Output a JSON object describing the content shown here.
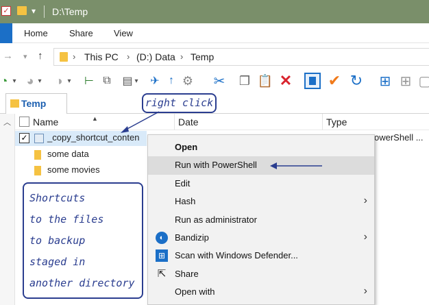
{
  "window": {
    "title": "D:\\Temp"
  },
  "ribbon": {
    "tabs": [
      "Home",
      "Share",
      "View"
    ]
  },
  "address": {
    "crumbs": [
      "This PC",
      "(D:) Data",
      "Temp"
    ]
  },
  "tabs": {
    "active_label": "Temp"
  },
  "columns": {
    "name": "Name",
    "date": "Date",
    "type": "Type"
  },
  "files": [
    {
      "name": "_copy_shortcut_conten",
      "type": "owerShell ...",
      "checked": true,
      "icon": "powershell-script-icon"
    },
    {
      "name": "some data",
      "icon": "shortcut-folder-icon"
    },
    {
      "name": "some movies",
      "icon": "shortcut-folder-icon"
    }
  ],
  "annotations": {
    "right_click": "right click",
    "note_lines": [
      "Shortcuts",
      "to the files",
      "to backup",
      "staged in",
      "another directory"
    ]
  },
  "context_menu": {
    "items": [
      {
        "label": "Open",
        "bold": true
      },
      {
        "label": "Run with PowerShell",
        "highlighted": true
      },
      {
        "label": "Edit"
      },
      {
        "label": "Hash",
        "submenu": true
      },
      {
        "label": "Run as administrator"
      },
      {
        "label": "Bandizip",
        "submenu": true,
        "icon": "bandizip-icon"
      },
      {
        "label": "Scan with Windows Defender...",
        "icon": "windows-defender-icon"
      },
      {
        "label": "Share",
        "icon": "share-icon"
      },
      {
        "label": "Open with",
        "submenu": true
      }
    ]
  },
  "colors": {
    "titlebar": "#7a8f6a",
    "accent": "#1b6fc7",
    "annotation": "#2a3d8f",
    "delete": "#d9232d"
  }
}
